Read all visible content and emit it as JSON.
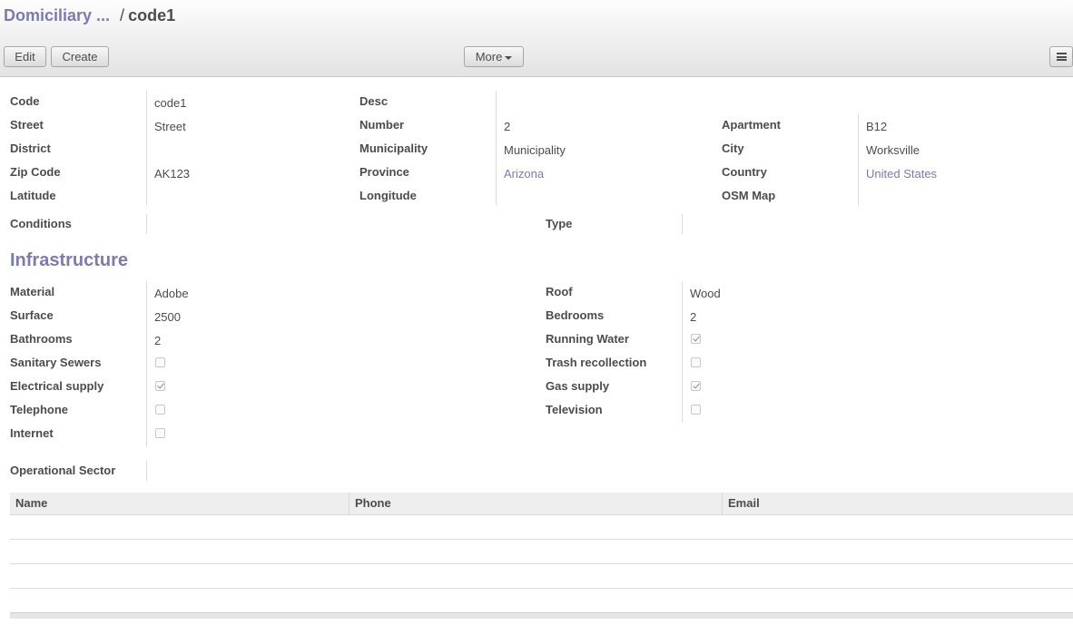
{
  "breadcrumb": {
    "parent": "Domiciliary ...",
    "separator": "/",
    "current": "code1"
  },
  "toolbar": {
    "edit_label": "Edit",
    "create_label": "Create",
    "more_label": "More",
    "menu_icon": "hamburger-icon"
  },
  "fields": {
    "code": {
      "label": "Code",
      "value": "code1"
    },
    "desc": {
      "label": "Desc",
      "value": ""
    },
    "street": {
      "label": "Street",
      "value": "Street"
    },
    "number": {
      "label": "Number",
      "value": "2"
    },
    "apartment": {
      "label": "Apartment",
      "value": "B12"
    },
    "district": {
      "label": "District",
      "value": ""
    },
    "municipality": {
      "label": "Municipality",
      "value": "Municipality"
    },
    "city": {
      "label": "City",
      "value": "Worksville"
    },
    "zip": {
      "label": "Zip Code",
      "value": "AK123"
    },
    "province": {
      "label": "Province",
      "value": "Arizona"
    },
    "country": {
      "label": "Country",
      "value": "United States"
    },
    "latitude": {
      "label": "Latitude",
      "value": ""
    },
    "longitude": {
      "label": "Longitude",
      "value": ""
    },
    "osm_map": {
      "label": "OSM Map",
      "value": ""
    },
    "conditions": {
      "label": "Conditions",
      "value": ""
    },
    "type": {
      "label": "Type",
      "value": ""
    }
  },
  "infrastructure": {
    "title": "Infrastructure",
    "material": {
      "label": "Material",
      "value": "Adobe"
    },
    "roof": {
      "label": "Roof",
      "value": "Wood"
    },
    "surface": {
      "label": "Surface",
      "value": "2500"
    },
    "bedrooms": {
      "label": "Bedrooms",
      "value": "2"
    },
    "bathrooms": {
      "label": "Bathrooms",
      "value": "2"
    },
    "running_water": {
      "label": "Running Water",
      "checked": true
    },
    "sanitary_sewers": {
      "label": "Sanitary Sewers",
      "checked": false
    },
    "trash_recollection": {
      "label": "Trash recollection",
      "checked": false
    },
    "electrical_supply": {
      "label": "Electrical supply",
      "checked": true
    },
    "gas_supply": {
      "label": "Gas supply",
      "checked": true
    },
    "telephone": {
      "label": "Telephone",
      "checked": false
    },
    "television": {
      "label": "Television",
      "checked": false
    },
    "internet": {
      "label": "Internet",
      "checked": false
    }
  },
  "operational_sector": {
    "label": "Operational Sector",
    "value": ""
  },
  "contacts_table": {
    "columns": [
      "Name",
      "Phone",
      "Email"
    ],
    "rows": []
  },
  "colors": {
    "link": "#7c7bad",
    "text": "#4c4c4c"
  }
}
